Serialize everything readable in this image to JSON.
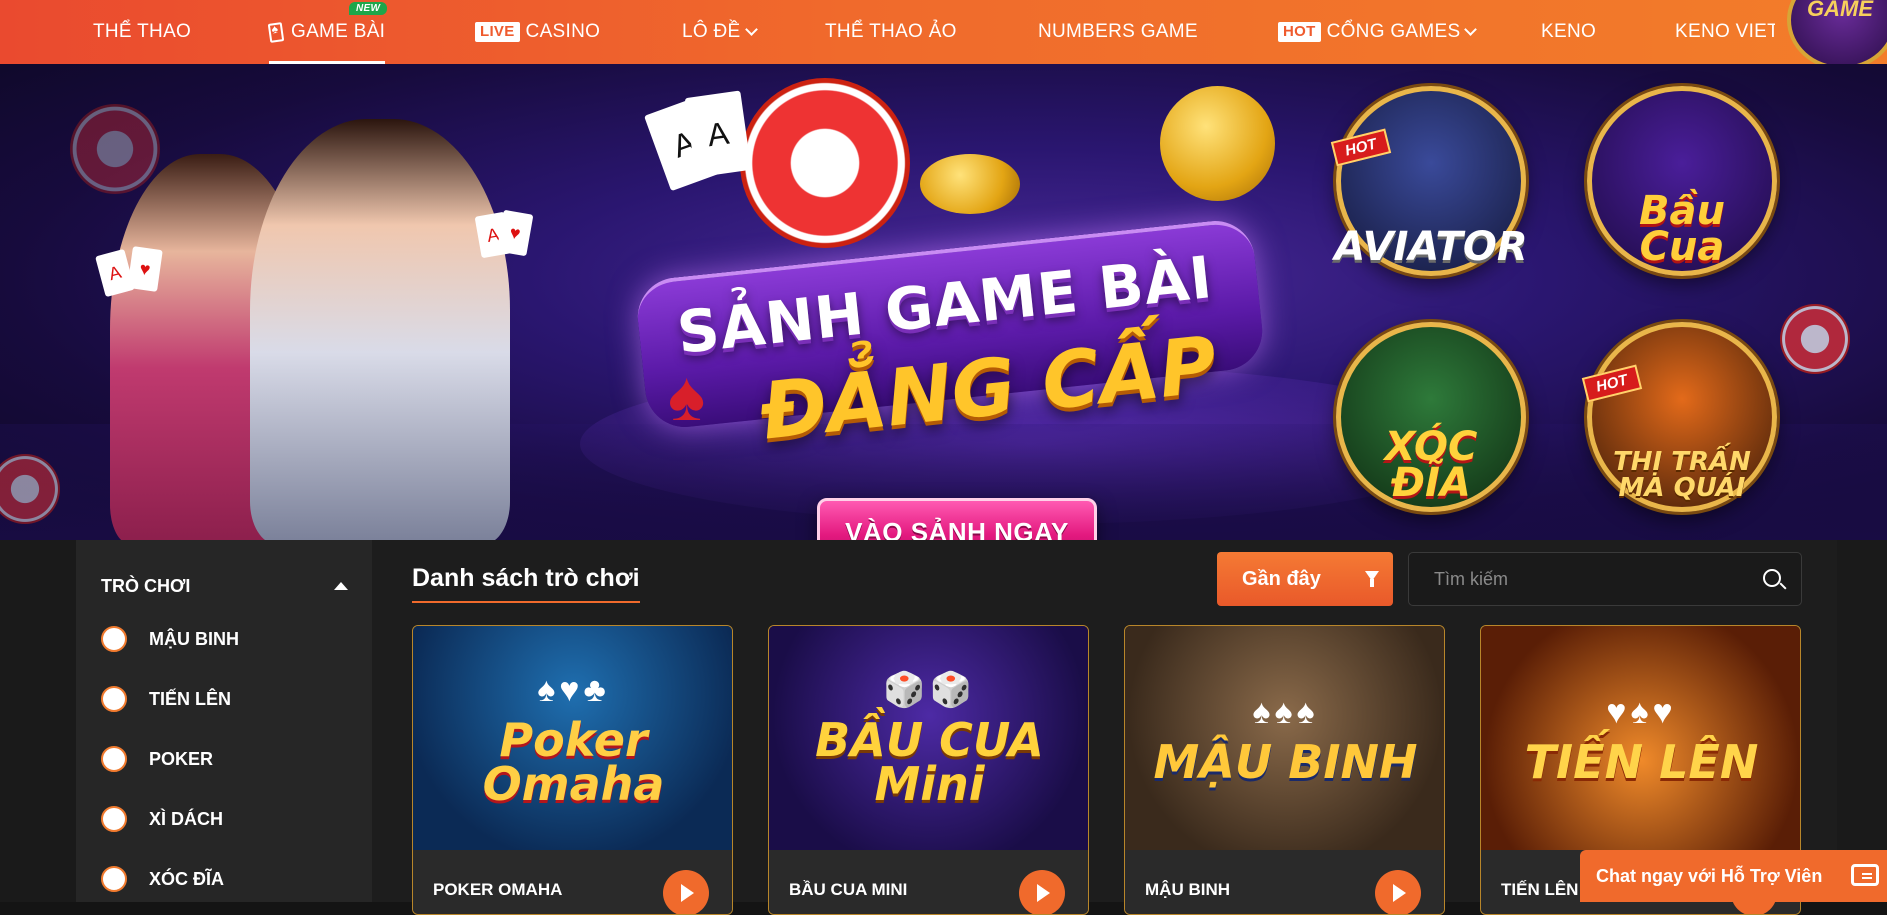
{
  "nav": {
    "items": [
      {
        "label": "THỂ THAO"
      },
      {
        "label": "GAME BÀI",
        "badge": "NEW"
      },
      {
        "tag": "LIVE",
        "label": "CASINO"
      },
      {
        "label": "LÔ ĐỀ"
      },
      {
        "label": "THỂ THAO ẢO"
      },
      {
        "label": "NUMBERS GAME"
      },
      {
        "tag": "HOT",
        "label": "CỔNG GAMES"
      },
      {
        "label": "KENO"
      },
      {
        "label": "KENO VIET"
      }
    ],
    "logo_text": "GAME",
    "accent": "#f06a2c"
  },
  "banner": {
    "title_line1": "SẢNH GAME BÀI",
    "title_line2": "ĐẲNG CẤP",
    "cta": "VÀO SẢNH NGAY",
    "medals": [
      {
        "label": "AVIATOR",
        "hot": "HOT"
      },
      {
        "label": "Bầu Cua"
      },
      {
        "label": "XÓC ĐĨA"
      },
      {
        "label": "THỊ TRẤN MA QUÁI",
        "hot": "HOT"
      }
    ]
  },
  "sidebar": {
    "heading": "TRÒ CHƠI",
    "items": [
      "MẬU BINH",
      "TIẾN LÊN",
      "POKER",
      "XÌ DÁCH",
      "XÓC ĐĨA"
    ]
  },
  "main": {
    "title": "Danh sách trò chơi",
    "sort_label": "Gần đây",
    "search_placeholder": "Tìm kiếm",
    "cards": [
      {
        "name": "POKER OMAHA",
        "thumb_title": "Poker Omaha",
        "thumb_deco": "♠♥♣"
      },
      {
        "name": "BẦU CUA MINI",
        "thumb_title": "BẦU CUA Mini",
        "thumb_deco": "🎲🎲"
      },
      {
        "name": "MẬU BINH",
        "thumb_title": "MẬU BINH",
        "thumb_deco": "♠♠♠"
      },
      {
        "name": "TIẾN LÊN",
        "thumb_title": "TIẾN LÊN",
        "thumb_deco": "♥♠♥"
      }
    ]
  },
  "chat": {
    "label": "Chat ngay với Hỗ Trợ Viên"
  }
}
